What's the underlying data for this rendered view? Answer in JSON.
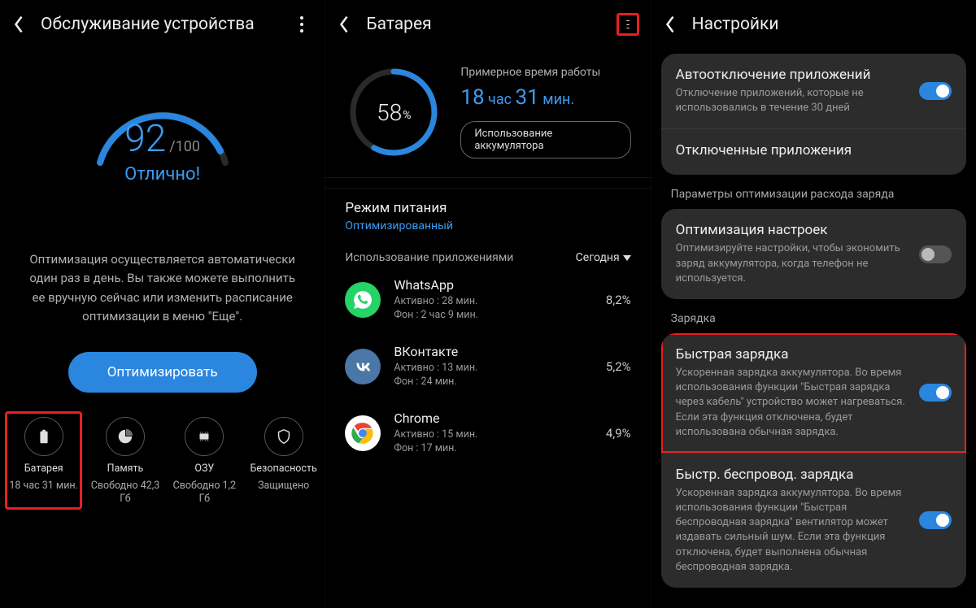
{
  "screen1": {
    "title": "Обслуживание устройства",
    "score": "92",
    "score_max": "/100",
    "score_label": "Отлично!",
    "desc": "Оптимизация осуществляется автоматически один раз в день. Вы также можете выполнить ее вручную сейчас или изменить расписание оптимизации в меню \"Еще\".",
    "optimize_btn": "Оптимизировать",
    "tiles": [
      {
        "name": "Батарея",
        "stat": "18 час 31 мин."
      },
      {
        "name": "Память",
        "stat": "Свободно 42,3 Гб"
      },
      {
        "name": "ОЗУ",
        "stat": "Свободно 1,2 Гб"
      },
      {
        "name": "Безопасность",
        "stat": "Защищено"
      }
    ]
  },
  "screen2": {
    "title": "Батарея",
    "pct": "58",
    "pct_sym": "%",
    "runtime_label": "Примерное время работы",
    "runtime": {
      "h": "18",
      "hlab": "час",
      "m": "31",
      "mlab": "мин."
    },
    "usage_chip": "Использование аккумулятора",
    "power_mode_title": "Режим питания",
    "power_mode_val": "Оптимизированный",
    "usage_by_apps": "Использование приложениями",
    "today": "Сегодня",
    "apps": [
      {
        "name": "WhatsApp",
        "active": "Активно : 28 мин.",
        "bg": "Фон : 2 час 9 мин.",
        "pct": "8,2%"
      },
      {
        "name": "ВКонтакте",
        "active": "Активно : 13 мин.",
        "bg": "Фон : 24 мин.",
        "pct": "5,2%"
      },
      {
        "name": "Chrome",
        "active": "Активно : 15 мин.",
        "bg": "Фон : 17 мин.",
        "pct": "4,9%"
      }
    ]
  },
  "screen3": {
    "title": "Настройки",
    "auto_off_title": "Автоотключение приложений",
    "auto_off_desc": "Отключение приложений, которые не использовались в течение 30 дней",
    "disabled_apps": "Отключенные приложения",
    "opt_section": "Параметры оптимизации расхода заряда",
    "opt_title": "Оптимизация настроек",
    "opt_desc": "Оптимизируйте настройки, чтобы экономить заряд аккумулятора, когда телефон не используется.",
    "charge_section": "Зарядка",
    "fast_title": "Быстрая зарядка",
    "fast_desc": "Ускоренная зарядка аккумулятора. Во время использования функции \"Быстрая зарядка через кабель\" устройство может нагреваться. Если эта функция отключена, будет использована обычная зарядка.",
    "wireless_title": "Быстр. беспровод. зарядка",
    "wireless_desc": "Ускоренная зарядка аккумулятора. Во время использования функции \"Быстрая беспроводная зарядка\" вентилятор может издавать сильный шум. Если эта функция отключена, будет выполнена обычная беспроводная зарядка."
  }
}
